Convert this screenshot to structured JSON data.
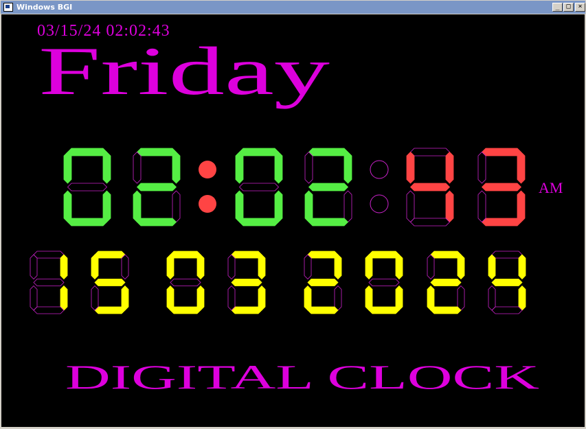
{
  "window": {
    "title": "Windows BGI"
  },
  "title_buttons": {
    "minimize": "_",
    "maximize": "□",
    "close": "×"
  },
  "clock": {
    "timestamp": "03/15/24 02:02:43",
    "day_name": "Friday",
    "time_digits": [
      "0",
      "2",
      "0",
      "2",
      "4",
      "3"
    ],
    "time_colors": [
      "#55ee44",
      "#55ee44",
      "#55ee44",
      "#55ee44",
      "#ff4444",
      "#ff4444"
    ],
    "colon1_lit": true,
    "colon2_lit": false,
    "meridiem": "AM",
    "date_digits": [
      "1",
      "5",
      "0",
      "3",
      "2",
      "0",
      "2",
      "4"
    ],
    "footer": "DIGITAL CLOCK"
  },
  "colors": {
    "magenta": "#dd00dd",
    "outline": "#cc22cc",
    "colon_on": "#ff4444",
    "date_digit": "#ffff00",
    "background": "#000000"
  }
}
